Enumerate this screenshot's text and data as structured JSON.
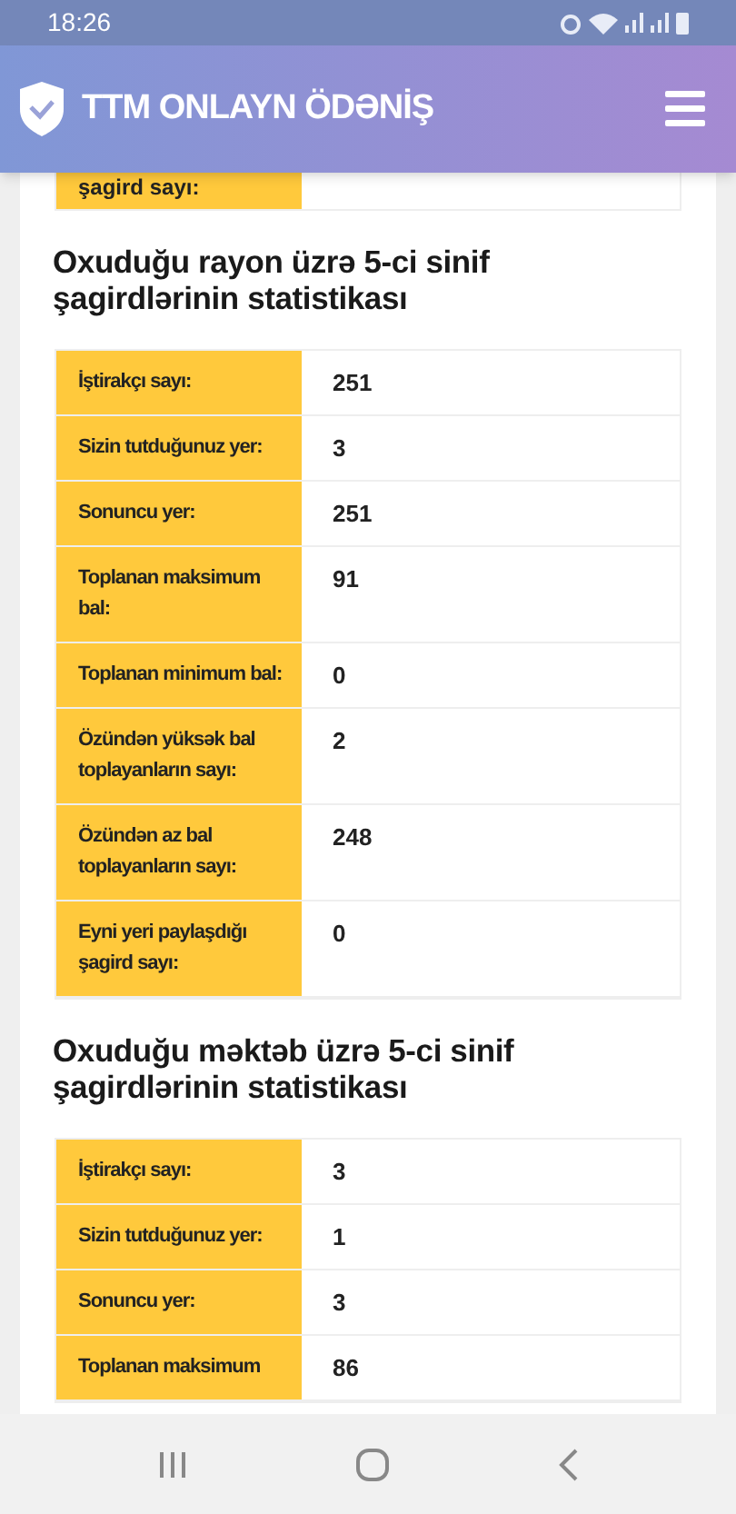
{
  "status_bar": {
    "time": "18:26"
  },
  "header": {
    "title": "TTM ONLAYN ÖDƏNİŞ"
  },
  "top_table": {
    "rows": [
      {
        "label": "şagird sayı:"
      }
    ]
  },
  "sections": [
    {
      "title": "Oxuduğu rayon üzrə 5-ci sinif şagirdlərinin statistikası",
      "rows": [
        {
          "label": "İştirakçı sayı:",
          "value": "251"
        },
        {
          "label": "Sizin tutduğunuz yer:",
          "value": "3"
        },
        {
          "label": "Sonuncu yer:",
          "value": "251"
        },
        {
          "label": "Toplanan maksimum bal:",
          "value": "91"
        },
        {
          "label": "Toplanan minimum bal:",
          "value": "0"
        },
        {
          "label": "Özündən yüksək bal toplayanların sayı:",
          "value": "2"
        },
        {
          "label": "Özündən az bal toplayanların sayı:",
          "value": "248"
        },
        {
          "label": "Eyni yeri paylaşdığı şagird sayı:",
          "value": "0"
        }
      ]
    },
    {
      "title": "Oxuduğu məktəb üzrə 5-ci sinif şagirdlərinin statistikası",
      "rows": [
        {
          "label": "İştirakçı sayı:",
          "value": "3"
        },
        {
          "label": "Sizin tutduğunuz yer:",
          "value": "1"
        },
        {
          "label": "Sonuncu yer:",
          "value": "3"
        },
        {
          "label": "Toplanan maksimum",
          "value": "86"
        }
      ]
    }
  ]
}
